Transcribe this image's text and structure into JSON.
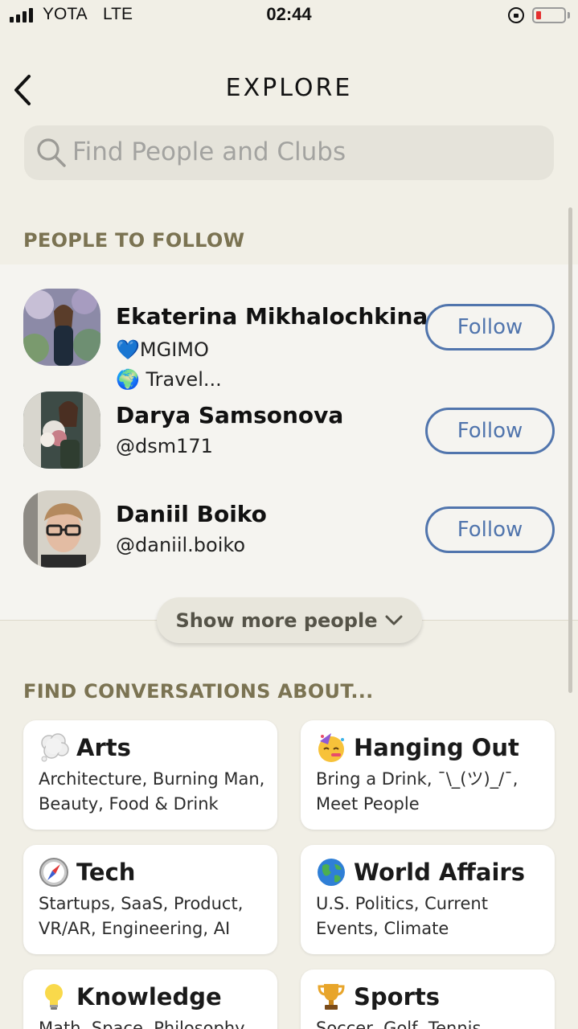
{
  "status_bar": {
    "carrier": "YOTA",
    "network": "LTE",
    "time": "02:44",
    "battery_level": 0.1
  },
  "header": {
    "title": "EXPLORE",
    "back_icon": "chevron-left-icon"
  },
  "search": {
    "placeholder": "Find People and Clubs",
    "icon": "search-icon"
  },
  "people_section": {
    "heading": "PEOPLE TO FOLLOW",
    "people": [
      {
        "name": "Ekaterina Mikhalochkina",
        "line1": "💙MGIMO",
        "line2": "🌍 Travel...",
        "follow_label": "Follow"
      },
      {
        "name": "Darya Samsonova",
        "line1": "@dsm171",
        "follow_label": "Follow"
      },
      {
        "name": "Daniil Boiko",
        "line1": "@daniil.boiko",
        "follow_label": "Follow"
      }
    ],
    "show_more_label": "Show more people",
    "accent_color": "#5175ad"
  },
  "topics_section": {
    "heading": "FIND CONVERSATIONS ABOUT...",
    "topics": [
      {
        "title": "Arts",
        "icon": "thought-bubble-icon",
        "description": "Architecture, Burning Man, Beauty, Food & Drink"
      },
      {
        "title": "Hanging Out",
        "icon": "party-face-icon",
        "description": "Bring a Drink, ¯\\_(ツ)_/¯, Meet People"
      },
      {
        "title": "Tech",
        "icon": "compass-icon",
        "description": "Startups, SaaS, Product, VR/AR, Engineering, AI"
      },
      {
        "title": "World Affairs",
        "icon": "globe-icon",
        "description": "U.S. Politics, Current Events, Climate"
      },
      {
        "title": "Knowledge",
        "icon": "light-bulb-icon",
        "description": "Math, Space, Philosophy"
      },
      {
        "title": "Sports",
        "icon": "trophy-icon",
        "description": "Soccer, Golf, Tennis"
      }
    ]
  }
}
